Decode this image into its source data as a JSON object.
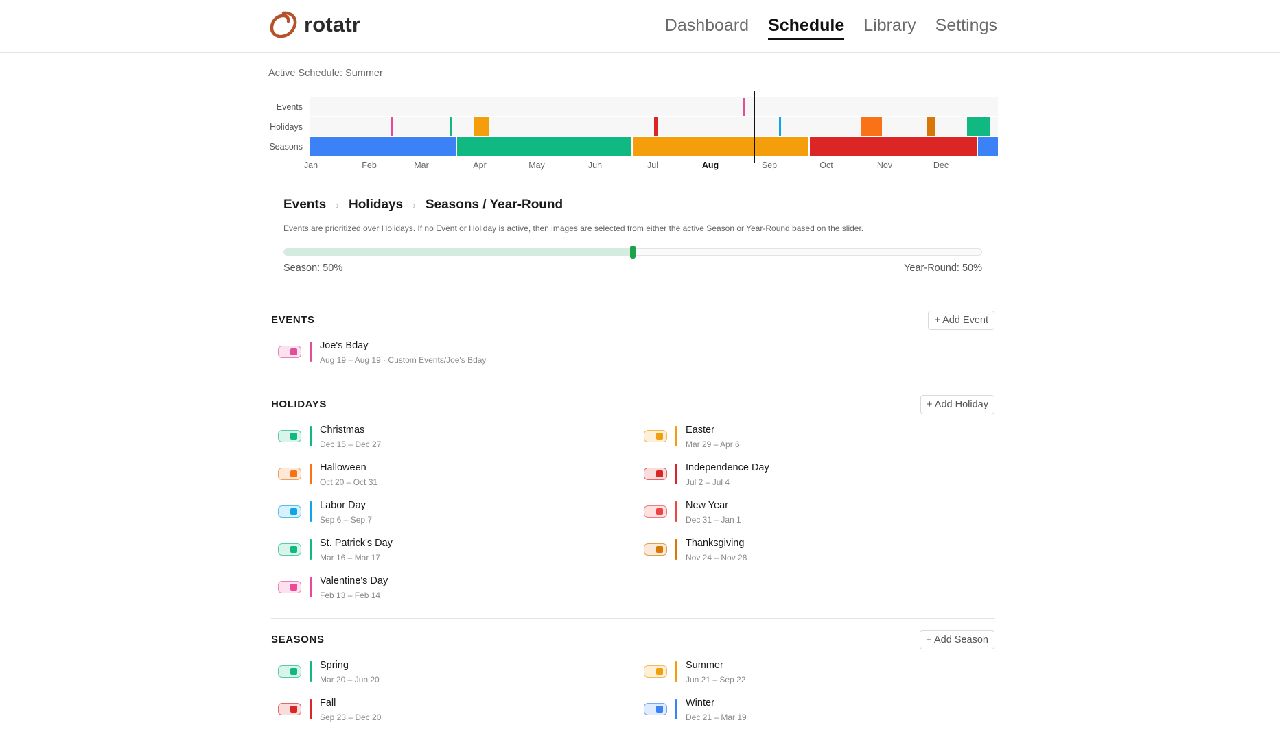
{
  "app": {
    "name": "rotatr",
    "logo_color": "#b5522b"
  },
  "nav": [
    {
      "label": "Dashboard",
      "active": false
    },
    {
      "label": "Schedule",
      "active": true
    },
    {
      "label": "Library",
      "active": false
    },
    {
      "label": "Settings",
      "active": false
    }
  ],
  "active_schedule": "Active Schedule: Summer",
  "timeline": {
    "row_labels": {
      "events": "Events",
      "holidays": "Holidays",
      "seasons": "Seasons"
    },
    "months": [
      "Jan",
      "Feb",
      "Mar",
      "Apr",
      "May",
      "Jun",
      "Jul",
      "Aug",
      "Sep",
      "Oct",
      "Nov",
      "Dec"
    ],
    "current_month": "Aug",
    "current_date": "Aug 19"
  },
  "priority": {
    "crumbs": [
      "Events",
      "Holidays",
      "Seasons / Year-Round"
    ],
    "description": "Events are prioritized over Holidays. If no Event or Holiday is active, then images are selected from either the active Season or Year-Round based on the slider.",
    "slider_value": 0.5,
    "left_label": "Season: 50%",
    "right_label": "Year-Round: 50%"
  },
  "sections": {
    "events": {
      "title": "EVENTS",
      "add_label": "+ Add Event",
      "items": [
        {
          "name": "Joe's Bday",
          "sub": "Aug 19 – Aug 19 · Custom Events/Joe's Bday",
          "color": "#e0509a",
          "enabled": true
        }
      ]
    },
    "holidays": {
      "title": "HOLIDAYS",
      "add_label": "+ Add Holiday",
      "items": [
        {
          "name": "Christmas",
          "sub": "Dec 15 – Dec 27",
          "color": "#10b981",
          "enabled": true
        },
        {
          "name": "Easter",
          "sub": "Mar 29 – Apr 6",
          "color": "#f59e0b",
          "enabled": true
        },
        {
          "name": "Halloween",
          "sub": "Oct 20 – Oct 31",
          "color": "#f97316",
          "enabled": true
        },
        {
          "name": "Independence Day",
          "sub": "Jul 2 – Jul 4",
          "color": "#dc2626",
          "enabled": true
        },
        {
          "name": "Labor Day",
          "sub": "Sep 6 – Sep 7",
          "color": "#0ea5e9",
          "enabled": true
        },
        {
          "name": "New Year",
          "sub": "Dec 31 – Jan 1",
          "color": "#ef4444",
          "enabled": true
        },
        {
          "name": "St. Patrick's Day",
          "sub": "Mar 16 – Mar 17",
          "color": "#10b981",
          "enabled": true
        },
        {
          "name": "Thanksgiving",
          "sub": "Nov 24 – Nov 28",
          "color": "#d97706",
          "enabled": true
        },
        {
          "name": "Valentine's Day",
          "sub": "Feb 13 – Feb 14",
          "color": "#ec4899",
          "enabled": true
        }
      ]
    },
    "seasons": {
      "title": "SEASONS",
      "add_label": "+ Add Season",
      "items": [
        {
          "name": "Spring",
          "sub": "Mar 20 – Jun 20",
          "color": "#10b981",
          "enabled": true
        },
        {
          "name": "Summer",
          "sub": "Jun 21 – Sep 22",
          "color": "#f59e0b",
          "enabled": true
        },
        {
          "name": "Fall",
          "sub": "Sep 23 – Dec 20",
          "color": "#dc2626",
          "enabled": true
        },
        {
          "name": "Winter",
          "sub": "Dec 21 – Mar 19",
          "color": "#3b82f6",
          "enabled": true
        }
      ]
    }
  }
}
